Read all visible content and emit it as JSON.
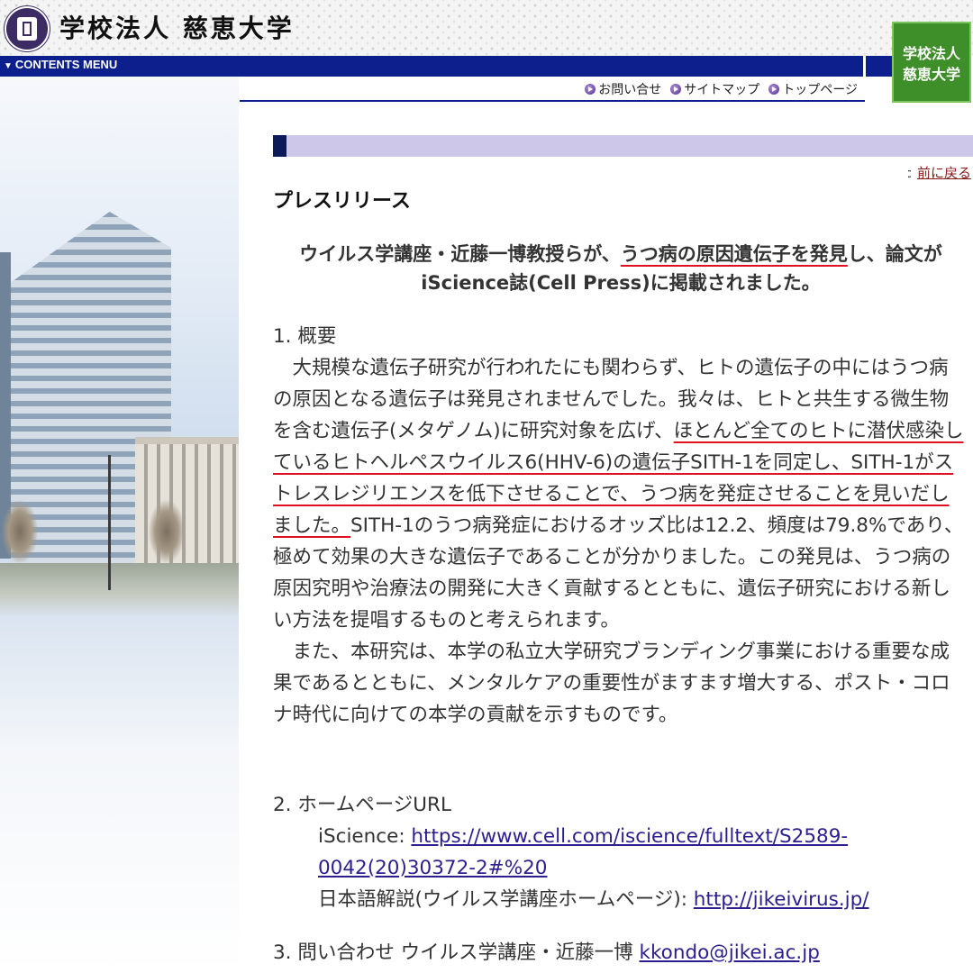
{
  "header": {
    "site_title": "学校法人 慈恵大学",
    "crest_icon": "university-crest-icon",
    "menu_label": "CONTENTS MENU",
    "badge_line1": "学校法人",
    "badge_line2": "慈恵大学",
    "brand_blue": "#0c1f8c",
    "badge_green": "#3e8f2a"
  },
  "top_links": [
    {
      "label": "お問い合せ"
    },
    {
      "label": "サイトマップ"
    },
    {
      "label": "トップページ"
    }
  ],
  "nav": {
    "back_label": "前に戻る"
  },
  "page": {
    "title": "プレスリリース",
    "headline_a": "ウイルス学講座・近藤一博教授らが、",
    "headline_b": "うつ病の原因遺伝子を発見",
    "headline_c": "し、論文がiScience誌(Cell Press)に掲載されました。"
  },
  "sections": {
    "s1_heading": "1. 概要",
    "p1_a": "大規模な遺伝子研究が行われたにも関わらず、ヒトの遺伝子の中にはうつ病の原因となる遺伝子は発見されませんでした。我々は、ヒトと共生する微生物を含む遺伝子(メタゲノム)に研究対象を広げ、",
    "p1_b": "ほとんど全てのヒトに潜伏感染しているヒトヘルペスウイルス6(HHV-6)の遺伝子SITH-1を同定し、SITH-1がストレスレジリエンスを低下させることで、うつ病を発症させることを見いだしました。",
    "p1_c": "SITH-1のうつ病発症におけるオッズ比は12.2、頻度は79.8%であり、極めて効果の大きな遺伝子であることが分かりました。この発見は、うつ病の原因究明や治療法の開発に大きく貢献するとともに、遺伝子研究における新しい方法を提唱するものと考えられます。",
    "p2": "また、本研究は、本学の私立大学研究ブランディング事業における重要な成果であるとともに、メンタルケアの重要性がますます増大する、ポスト・コロナ時代に向けての本学の貢献を示すものです。",
    "s2_heading": "2.  ホームページURL",
    "iscience_label": "iScience: ",
    "iscience_url": "https://www.cell.com/iscience/fulltext/S2589-0042(20)30372-2#%20",
    "jp_label": "日本語解説(ウイルス学講座ホームページ): ",
    "jp_url": "http://jikeivirus.jp/",
    "s3_heading": "3.  問い合わせ ウイルス学講座・近藤一博 ",
    "contact_email": "kkondo@jikei.ac.jp"
  }
}
